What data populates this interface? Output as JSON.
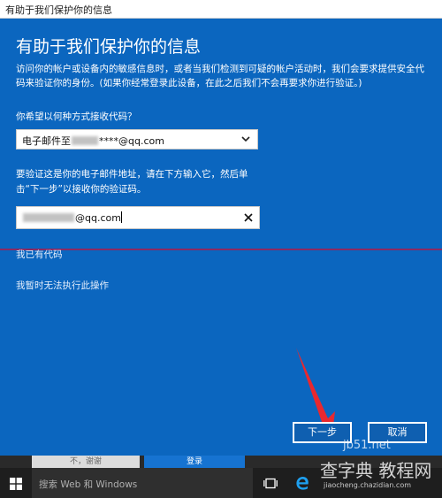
{
  "window": {
    "title": "有助于我们保护你的信息"
  },
  "dialog": {
    "heading": "有助于我们保护你的信息",
    "description": "访问你的帐户或设备内的敏感信息时，或者当我们检测到可疑的帐户活动时，我们会要求提供安全代码来验证你的身份。(如果你经常登录此设备，在此之后我们不会再要求你进行验证。)",
    "question_label": "你希望以何种方式接收代码？",
    "select": {
      "prefix": "电子邮件至",
      "suffix": "****@qq.com"
    },
    "verify_description": "要验证这是你的电子邮件地址，请在下方输入它，然后单击“下一步”以接收你的验证码。",
    "email_input": {
      "value_suffix": "@qq.com"
    },
    "link_have_code": "我已有代码",
    "link_cannot_do": "我暂时无法执行此操作",
    "next_button": "下一步",
    "cancel_button": "取消"
  },
  "background": {
    "left_button": "不，谢谢",
    "right_button": "登录"
  },
  "taskbar": {
    "search_placeholder": "搜索 Web 和 Windows"
  },
  "watermark": {
    "line1": "jb51.net",
    "line2": "查字典 教程网",
    "line3": "jiaocheng.chazidian.com"
  },
  "colors": {
    "dialog_bg": "#0b66bf",
    "annotation_arrow": "#e8282f"
  }
}
